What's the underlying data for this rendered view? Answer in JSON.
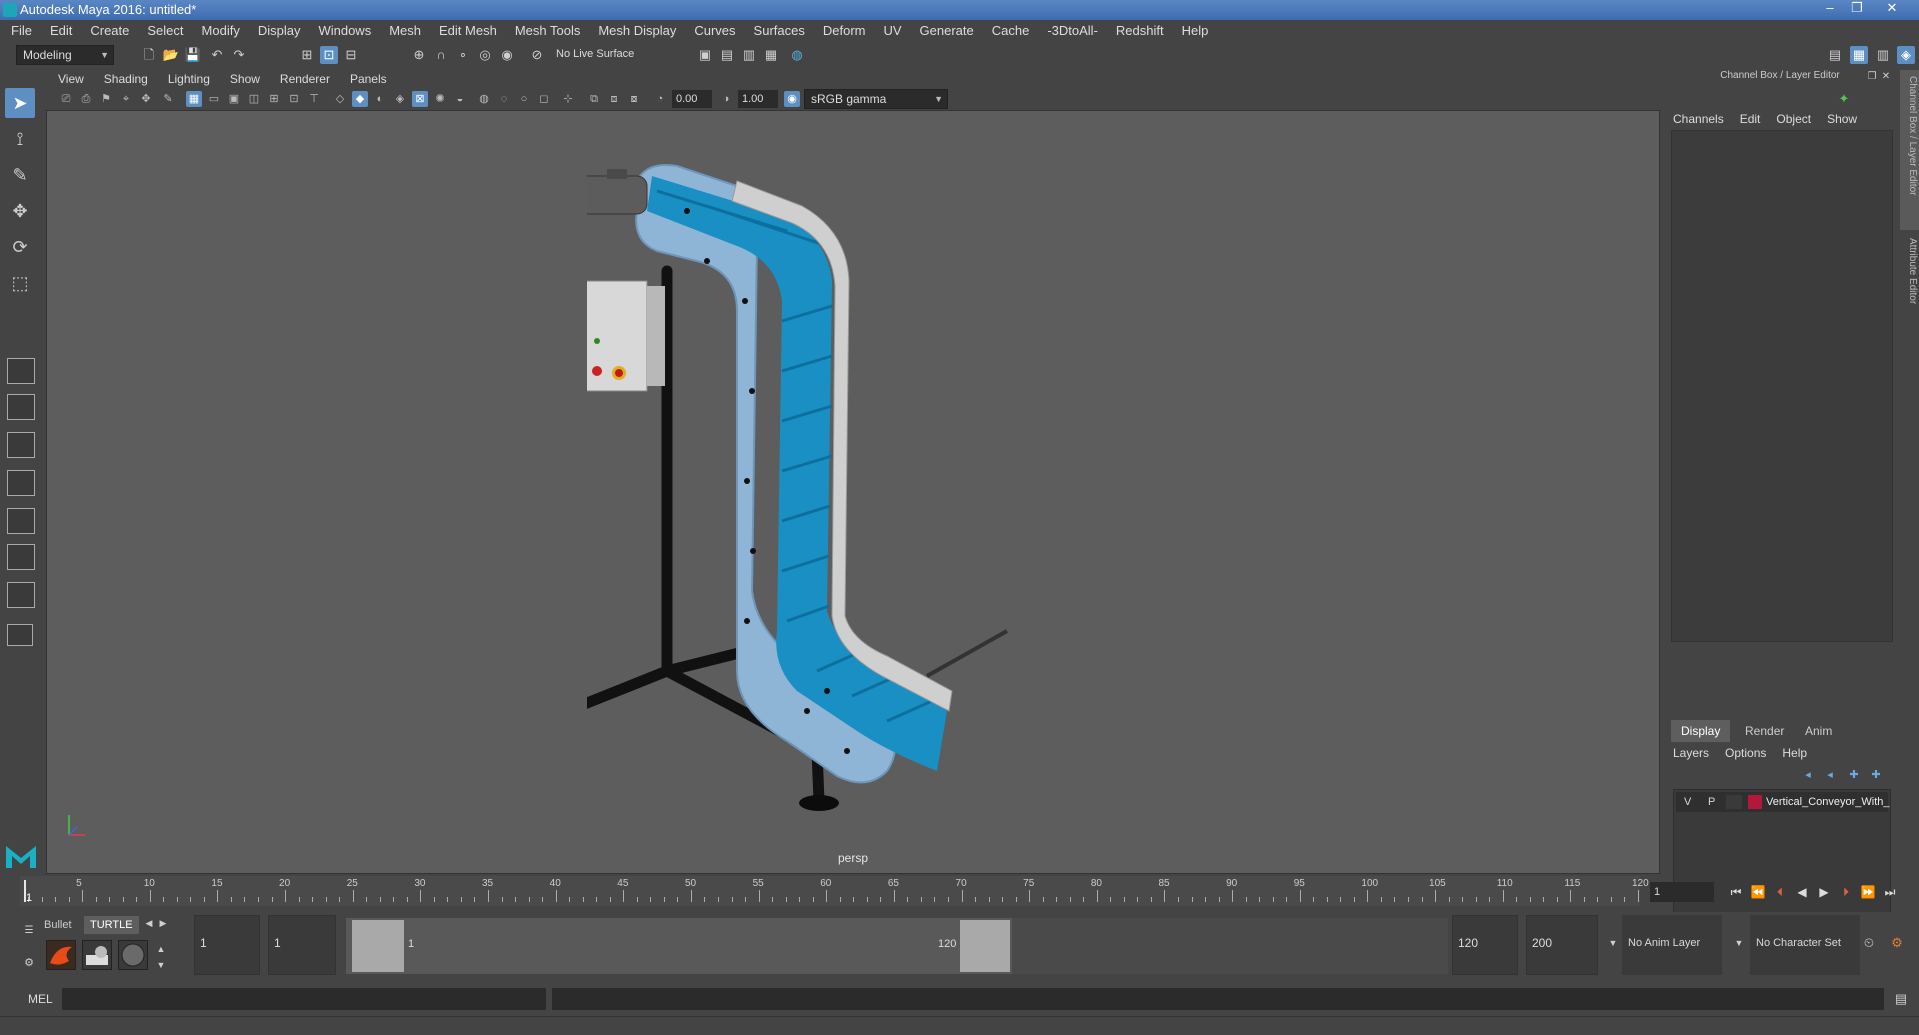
{
  "window": {
    "title": "Autodesk Maya 2016: untitled*"
  },
  "menus": [
    "File",
    "Edit",
    "Create",
    "Select",
    "Modify",
    "Display",
    "Windows",
    "Mesh",
    "Edit Mesh",
    "Mesh Tools",
    "Mesh Display",
    "Curves",
    "Surfaces",
    "Deform",
    "UV",
    "Generate",
    "Cache",
    "-3DtoAll-",
    "Redshift",
    "Help"
  ],
  "statusline": {
    "menuset": "Modeling",
    "live_surface": "No Live Surface"
  },
  "viewport": {
    "menus": [
      "View",
      "Shading",
      "Lighting",
      "Show",
      "Renderer",
      "Panels"
    ],
    "exposure": "0.00",
    "gamma": "1.00",
    "colorspace": "sRGB gamma",
    "camera": "persp"
  },
  "right_panel": {
    "header": "Channel Box / Layer Editor",
    "channel_menus": [
      "Channels",
      "Edit",
      "Object",
      "Show"
    ],
    "tabs": [
      "Display",
      "Render",
      "Anim"
    ],
    "active_tab": "Display",
    "layer_menus": [
      "Layers",
      "Options",
      "Help"
    ],
    "layer": {
      "v": "V",
      "p": "P",
      "name": "Vertical_Conveyor_With_",
      "color": "#b3183a"
    },
    "side_tabs": [
      "Channel Box / Layer Editor",
      "Attribute Editor"
    ]
  },
  "timeline": {
    "labels": [
      "5",
      "10",
      "15",
      "20",
      "25",
      "30",
      "35",
      "40",
      "45",
      "50",
      "55",
      "60",
      "65",
      "70",
      "75",
      "80",
      "85",
      "90",
      "95",
      "100",
      "105",
      "110",
      "115",
      "120"
    ],
    "current": "1",
    "current_frame_field": "1"
  },
  "range": {
    "start": "1",
    "anim_start": "1",
    "slider_start": "1",
    "slider_end": "120",
    "end": "120",
    "anim_end": "200",
    "anim_layer": "No Anim Layer",
    "character_set": "No Character Set"
  },
  "shelf": {
    "tabs": [
      "Bullet",
      "TURTLE"
    ]
  },
  "command": {
    "language": "MEL"
  },
  "colors": {
    "accent": "#5d8fc2",
    "belt": "#1a8fc4",
    "frame": "#8fb5d6"
  }
}
